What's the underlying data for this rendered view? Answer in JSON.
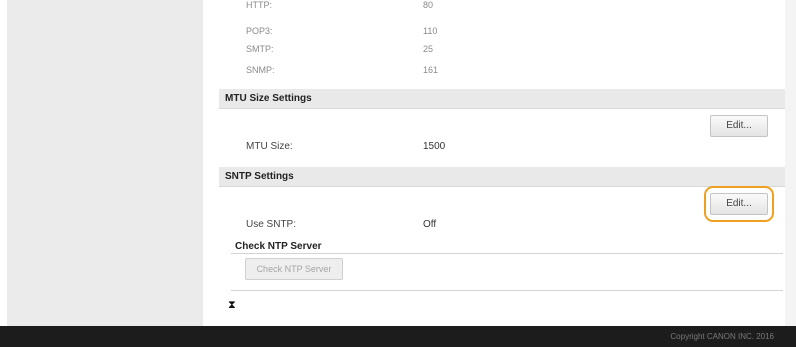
{
  "ports": [
    {
      "label": "HTTP:",
      "value": "80"
    },
    {
      "label": "POP3:",
      "value": "110"
    },
    {
      "label": "SMTP:",
      "value": "25"
    },
    {
      "label": "SNMP:",
      "value": "161"
    }
  ],
  "mtu": {
    "header": "MTU Size Settings",
    "edit_label": "Edit...",
    "size_label": "MTU Size:",
    "size_value": "1500"
  },
  "sntp": {
    "header": "SNTP Settings",
    "edit_label": "Edit...",
    "use_label": "Use SNTP:",
    "use_value": "Off",
    "check_heading": "Check NTP Server",
    "check_button": "Check NTP Server"
  },
  "scroll_top_icon": "⧗",
  "footer": {
    "copyright": "Copyright CANON INC. 2016"
  },
  "colors": {
    "highlight": "#f0a020",
    "footer": "#1c1c1c"
  }
}
